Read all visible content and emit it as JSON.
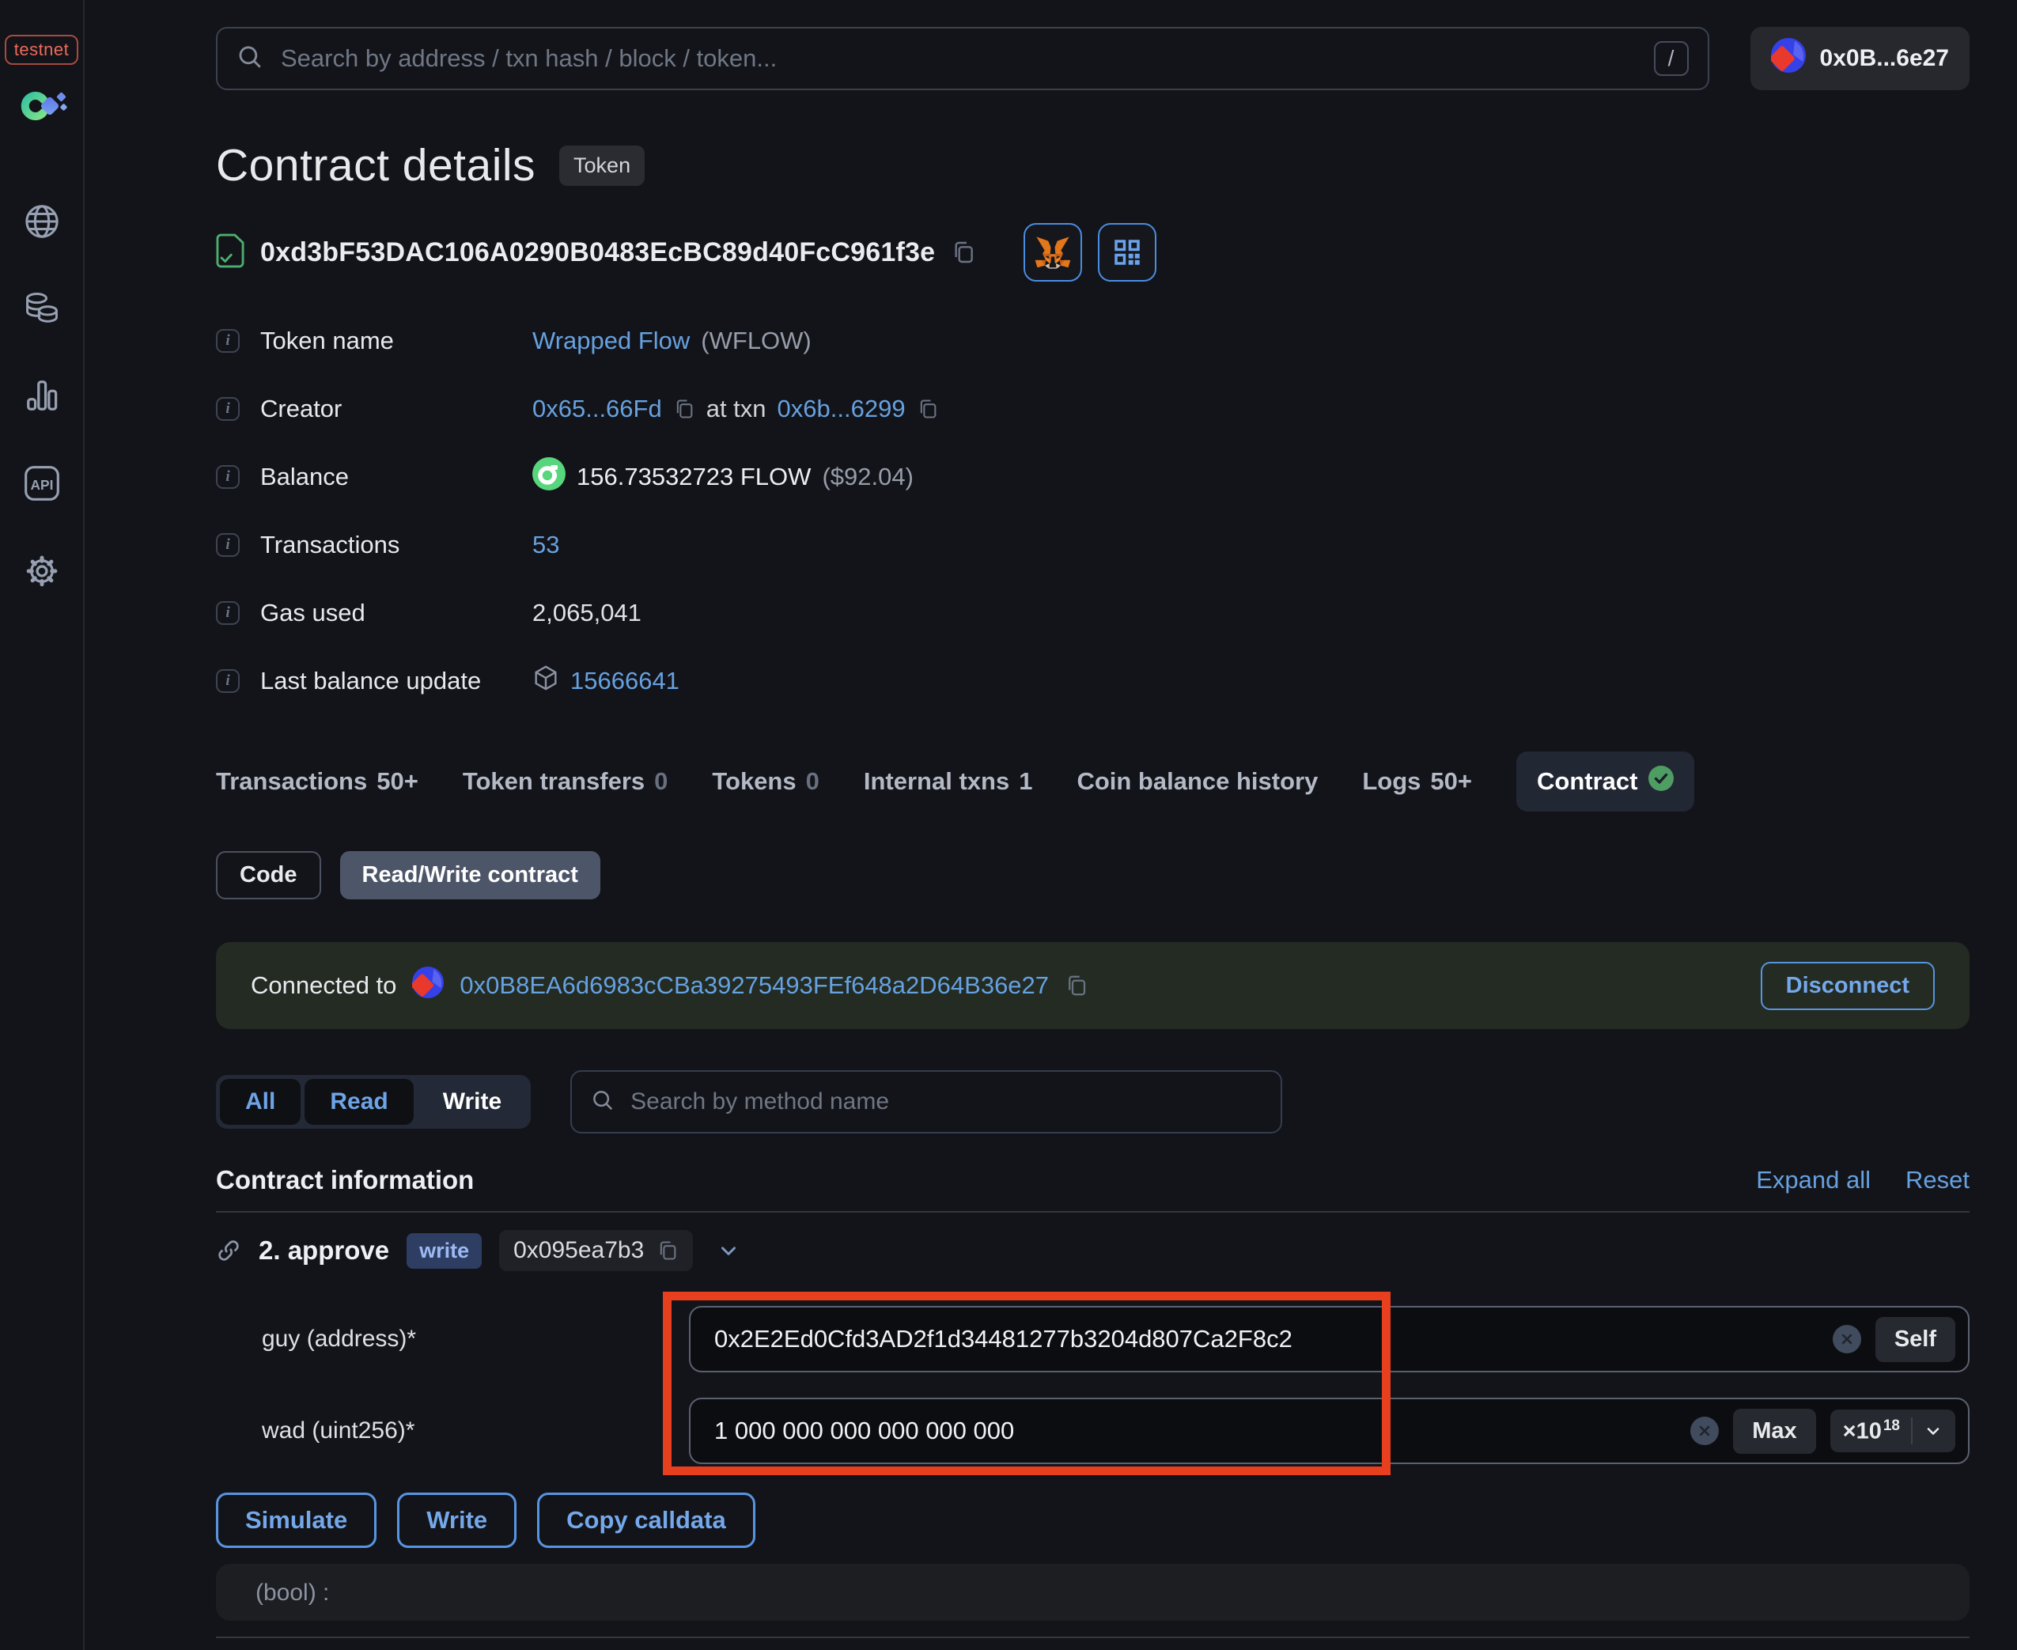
{
  "colors": {
    "background": "#131419",
    "link_blue": "#66a1e0",
    "accent_blue_border": "#5795e2",
    "annotation_red": "#e8401f",
    "success_green": "#57d67d",
    "check_circle_green": "#4e9d63",
    "metamask_orange": "#e2761b",
    "connected_banner_bg": "#232b23",
    "testnet_red": "#ec6a5c"
  },
  "icons": [
    "globe",
    "tokens",
    "stats",
    "api",
    "settings",
    "search",
    "slash-kbd",
    "copy",
    "verified-contract",
    "metamask-fox",
    "qr-code",
    "info",
    "flow-coin",
    "block-cube",
    "link-chain",
    "chevron-down",
    "clear-x",
    "check-circle"
  ],
  "sidebar": {
    "network_badge": "testnet"
  },
  "topbar": {
    "search_placeholder": "Search by address / txn hash / block / token...",
    "search_shortcut": "/",
    "account_label": "0x0B...6e27"
  },
  "header": {
    "title": "Contract details",
    "type_badge": "Token",
    "address": "0xd3bF53DAC106A0290B0483EcBC89d40FcC961f3e"
  },
  "info_rows": [
    {
      "label": "Token name",
      "link": "Wrapped Flow",
      "suffix": "(WFLOW)"
    },
    {
      "label": "Creator",
      "address": "0x65...66Fd",
      "mid": "at txn",
      "txn": "0x6b...6299"
    },
    {
      "label": "Balance",
      "amount": "156.73532723 FLOW",
      "usd": "($92.04)"
    },
    {
      "label": "Transactions",
      "value": "53"
    },
    {
      "label": "Gas used",
      "value": "2,065,041"
    },
    {
      "label": "Last balance update",
      "block": "15666641"
    }
  ],
  "tabs": [
    {
      "label": "Transactions",
      "count": "50+"
    },
    {
      "label": "Token transfers",
      "count": "0"
    },
    {
      "label": "Tokens",
      "count": "0"
    },
    {
      "label": "Internal txns",
      "count": "1"
    },
    {
      "label": "Coin balance history",
      "count": ""
    },
    {
      "label": "Logs",
      "count": "50+"
    },
    {
      "label": "Contract",
      "count": ""
    }
  ],
  "subtabs": {
    "code": "Code",
    "read_write": "Read/Write contract"
  },
  "connected": {
    "prefix": "Connected to",
    "address": "0x0B8EA6d6983cCBa39275493FEf648a2D64B36e27",
    "disconnect": "Disconnect"
  },
  "filters": {
    "options": [
      "All",
      "Read",
      "Write"
    ],
    "selected": "Write",
    "search_placeholder": "Search by method name"
  },
  "section": {
    "title": "Contract information",
    "expand_all": "Expand all",
    "reset": "Reset"
  },
  "method": {
    "name": "2. approve",
    "type_badge": "write",
    "selector": "0x095ea7b3"
  },
  "params": [
    {
      "label": "guy (address)*",
      "value": "0x2E2Ed0Cfd3AD2f1d34481277b3204d807Ca2F8c2",
      "action": "Self"
    },
    {
      "label": "wad (uint256)*",
      "value": "1 000 000 000 000 000 000",
      "action": "Max",
      "multiplier_base": "×10",
      "multiplier_exp": "18"
    }
  ],
  "actions": {
    "simulate": "Simulate",
    "write": "Write",
    "copy_calldata": "Copy calldata"
  },
  "output": {
    "label": "(bool) :"
  }
}
